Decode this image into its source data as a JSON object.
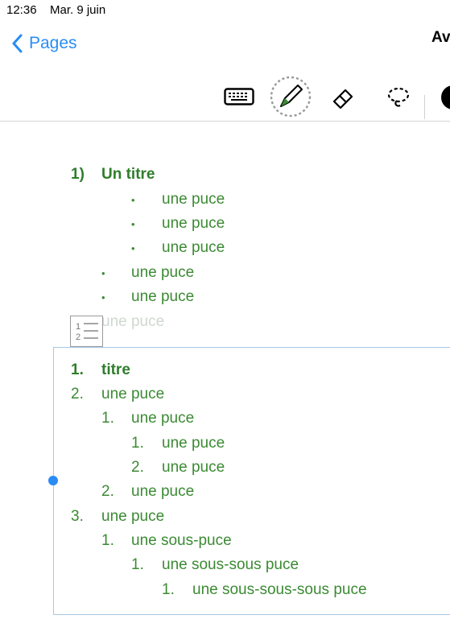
{
  "status_bar": {
    "time": "12:36",
    "date": "Mar. 9 juin"
  },
  "nav": {
    "back_label": "Pages",
    "title": "Av"
  },
  "toolbar": {
    "icons": [
      "keyboard-icon",
      "pen-icon",
      "eraser-icon",
      "lasso-icon",
      "color-dot-icon"
    ]
  },
  "colors": {
    "text_green": "#3b8a33",
    "accent_blue": "#2a8cf4",
    "selection_border": "#a9c8e6"
  },
  "doc": {
    "section1": {
      "title_num": "1)",
      "title": "Un titre",
      "sub_bullets": [
        "une puce",
        "une puce",
        "une puce"
      ],
      "bullets": [
        "une puce",
        "une puce"
      ],
      "faded_line": "une puce"
    },
    "section2": {
      "lines": [
        {
          "num": "1.",
          "text": "titre"
        },
        {
          "num": "2.",
          "text": "une puce"
        },
        {
          "num": "1.",
          "text": "une puce"
        },
        {
          "num": "1.",
          "text": "une puce"
        },
        {
          "num": "2.",
          "text": "une puce"
        },
        {
          "num": "2.",
          "text": "une puce"
        },
        {
          "num": "3.",
          "text": "une puce"
        },
        {
          "num": "1.",
          "text": "une sous-puce"
        },
        {
          "num": "1.",
          "text": "une sous-sous puce"
        },
        {
          "num": "1.",
          "text": "une sous-sous-sous puce"
        }
      ]
    },
    "list_icon_digits": [
      "1",
      "2"
    ]
  }
}
